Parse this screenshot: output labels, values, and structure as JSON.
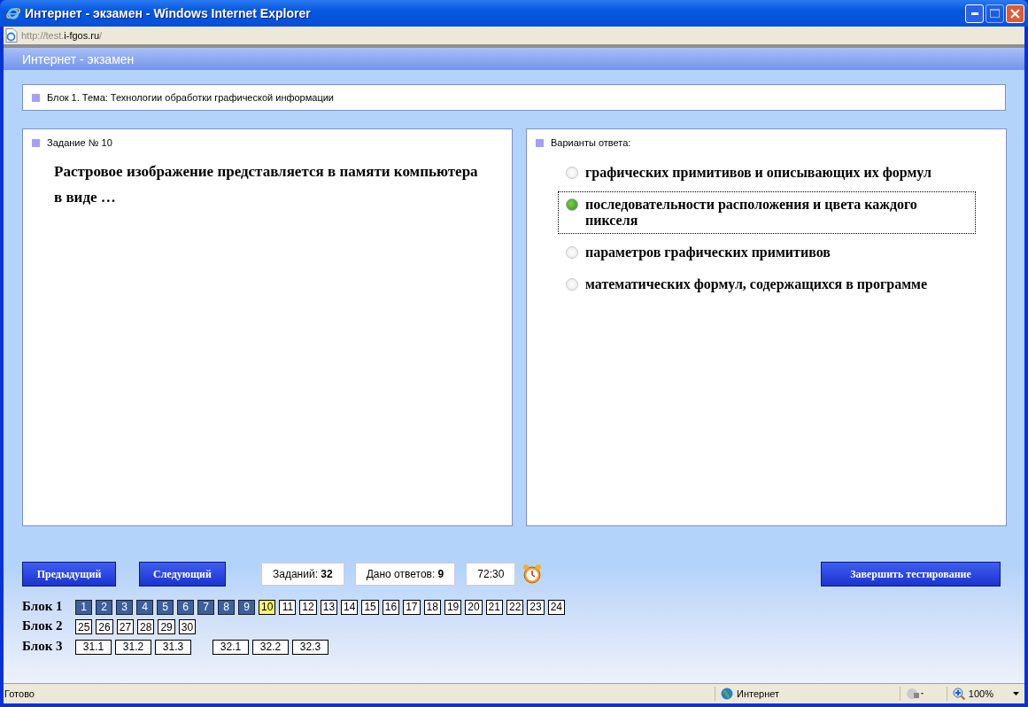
{
  "window": {
    "title": "Интернет - экзамен - Windows Internet Explorer"
  },
  "address": {
    "prefix": "http://test.",
    "host": "i-fgos.ru",
    "suffix": "/"
  },
  "page_title": "Интернет - экзамен",
  "block_header": "Блок 1. Тема: Технологии обработки графической информации",
  "task": {
    "heading": "Задание № 10",
    "question": "Растровое изображение представляется в памяти компьютера в виде …"
  },
  "answers": {
    "heading": "Варианты ответа:",
    "options": [
      {
        "text": "графических примитивов и описывающих их формул",
        "selected": false
      },
      {
        "text": "последовательности расположения и цвета каждого пикселя",
        "selected": true
      },
      {
        "text": "параметров графических примитивов",
        "selected": false
      },
      {
        "text": "математических формул, содержащихся в программе",
        "selected": false
      }
    ]
  },
  "buttons": {
    "prev": "Предыдущий",
    "next": "Следующий",
    "finish": "Завершить тестирование"
  },
  "counters": [
    {
      "text": "Заданий: **32**"
    },
    {
      "text": "Дано ответов: **9**"
    },
    {
      "text": "72:30"
    }
  ],
  "blocks": [
    {
      "label": "Блок 1",
      "groups": [
        [
          {
            "n": "1",
            "answered": true,
            "current": false
          },
          {
            "n": "2",
            "answered": true,
            "current": false
          },
          {
            "n": "3",
            "answered": true,
            "current": false
          },
          {
            "n": "4",
            "answered": true,
            "current": false
          },
          {
            "n": "5",
            "answered": true,
            "current": false
          },
          {
            "n": "6",
            "answered": true,
            "current": false
          },
          {
            "n": "7",
            "answered": true,
            "current": false
          },
          {
            "n": "8",
            "answered": true,
            "current": false
          },
          {
            "n": "9",
            "answered": true,
            "current": false
          },
          {
            "n": "10",
            "answered": false,
            "current": true
          },
          {
            "n": "11",
            "answered": false,
            "current": false
          },
          {
            "n": "12",
            "answered": false,
            "current": false
          },
          {
            "n": "13",
            "answered": false,
            "current": false
          },
          {
            "n": "14",
            "answered": false,
            "current": false
          },
          {
            "n": "15",
            "answered": false,
            "current": false
          },
          {
            "n": "16",
            "answered": false,
            "current": false
          },
          {
            "n": "17",
            "answered": false,
            "current": false
          },
          {
            "n": "18",
            "answered": false,
            "current": false
          },
          {
            "n": "19",
            "answered": false,
            "current": false
          },
          {
            "n": "20",
            "answered": false,
            "current": false
          },
          {
            "n": "21",
            "answered": false,
            "current": false
          },
          {
            "n": "22",
            "answered": false,
            "current": false
          },
          {
            "n": "23",
            "answered": false,
            "current": false
          },
          {
            "n": "24",
            "answered": false,
            "current": false
          }
        ]
      ]
    },
    {
      "label": "Блок 2",
      "groups": [
        [
          {
            "n": "25",
            "answered": false,
            "current": false
          },
          {
            "n": "26",
            "answered": false,
            "current": false
          },
          {
            "n": "27",
            "answered": false,
            "current": false
          },
          {
            "n": "28",
            "answered": false,
            "current": false
          },
          {
            "n": "29",
            "answered": false,
            "current": false
          },
          {
            "n": "30",
            "answered": false,
            "current": false
          }
        ]
      ]
    },
    {
      "label": "Блок 3",
      "groups": [
        [
          {
            "n": "31.1",
            "answered": false,
            "current": false
          },
          {
            "n": "31.2",
            "answered": false,
            "current": false
          },
          {
            "n": "31.3",
            "answered": false,
            "current": false
          }
        ],
        [
          {
            "n": "32.1",
            "answered": false,
            "current": false
          },
          {
            "n": "32.2",
            "answered": false,
            "current": false
          },
          {
            "n": "32.3",
            "answered": false,
            "current": false
          }
        ]
      ]
    }
  ],
  "status_bar": {
    "text": "Готово",
    "zone": "Интернет",
    "zoom": "100%"
  }
}
